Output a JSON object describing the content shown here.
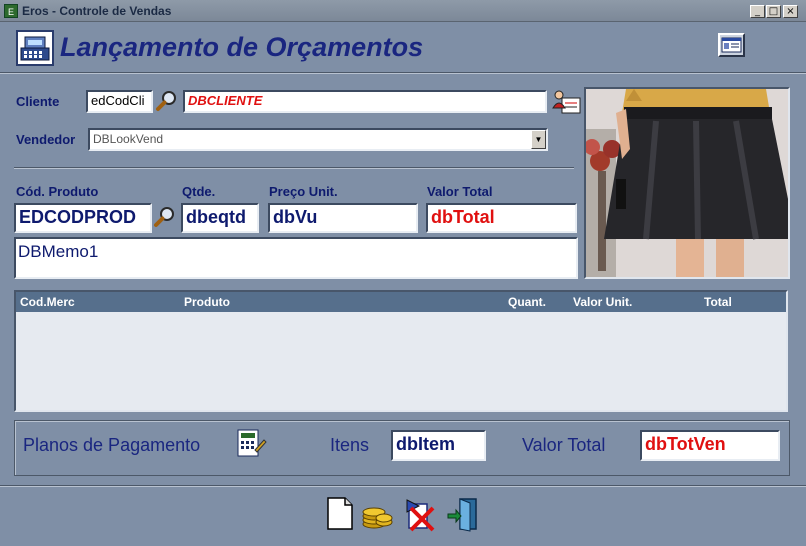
{
  "window": {
    "title": "Eros - Controle de Vendas"
  },
  "window_buttons": {
    "minimize": "_",
    "maximize": "□",
    "close": "×"
  },
  "header": {
    "title": "Lançamento de Orçamentos"
  },
  "cliente": {
    "label": "Cliente",
    "code_value": "edCodCli",
    "name_value": "DBCLIENTE"
  },
  "vendedor": {
    "label": "Vendedor",
    "value": "DBLookVend"
  },
  "produto": {
    "cod_label": "Cód. Produto",
    "cod_value": "EDCODPROD",
    "qtde_label": "Qtde.",
    "qtde_value": "dbeqtd",
    "preco_label": "Preço Unit.",
    "preco_value": "dbVu",
    "total_label": "Valor Total",
    "total_value": "dbTotal",
    "memo_value": "DBMemo1"
  },
  "grid": {
    "columns": [
      "Cod.Merc",
      "Produto",
      "Quant.",
      "Valor Unit.",
      "Total"
    ]
  },
  "footer": {
    "planos_label": "Planos de Pagamento",
    "itens_label": "Itens",
    "itens_value": "dbItem",
    "total_label": "Valor Total",
    "total_value": "dbTotVen"
  },
  "colors": {
    "accent_red": "#e01010",
    "navy": "#0e1a6e"
  },
  "toolbar_icons": [
    "new-document-icon",
    "coins-icon",
    "cancel-icon",
    "exit-door-icon"
  ]
}
